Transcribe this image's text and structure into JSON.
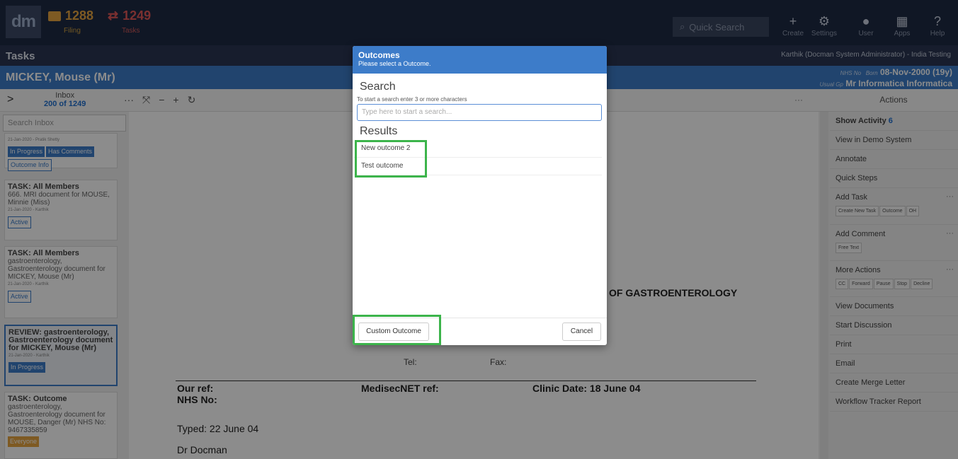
{
  "topbar": {
    "logo": "dm",
    "filing_count": "1288",
    "filing_label": "Filing",
    "tasks_count": "1249",
    "tasks_label": "Tasks",
    "quick_search_placeholder": "Quick Search",
    "nav": [
      {
        "label": "Create",
        "icon": "plus-icon"
      },
      {
        "label": "Settings",
        "icon": "gear-icon"
      },
      {
        "label": "User",
        "icon": "user-icon"
      },
      {
        "label": "Apps",
        "icon": "grid-icon"
      },
      {
        "label": "Help",
        "icon": "help-icon"
      }
    ]
  },
  "header": {
    "title": "Tasks",
    "user": "Karthik (Docman System Administrator) - India Testing"
  },
  "patient": {
    "name": "MICKEY, Mouse (Mr)",
    "nhs_label": "NHS No",
    "born_label": "Born",
    "born": "08-Nov-2000 (19y)",
    "gp_label": "Usual Gp",
    "gp": "Mr Informatica Informatica"
  },
  "inbox": {
    "label": "Inbox",
    "count": "200 of 1249",
    "search_placeholder": "Search Inbox",
    "cards": [
      {
        "type": "",
        "lines": "",
        "date": "21-Jan-2020 - Pratik Shetty",
        "tags": [
          "In Progress",
          "Has Comments",
          "Outcome Info"
        ]
      },
      {
        "type": "TASK: All Members",
        "lines": "666. MRI document for MOUSE, Minnie (Miss)",
        "date": "21-Jan-2020 - Karthik",
        "tags": [
          "Active"
        ]
      },
      {
        "type": "TASK: All Members",
        "lines": "gastroenterology, Gastroenterology document for MICKEY, Mouse (Mr)",
        "date": "21-Jan-2020 - Karthik",
        "tags": [
          "Active"
        ]
      },
      {
        "type": "REVIEW: gastroenterology, Gastroenterology document for MICKEY, Mouse (Mr)",
        "lines": "",
        "date": "21-Jan-2020 - Karthik",
        "tags": [
          "In Progress"
        ]
      },
      {
        "type": "TASK: Outcome",
        "lines": "gastroenterology, Gastroenterology document for MOUSE, Danger (Mr) NHS No: 9467335859",
        "date": "",
        "tags": [
          "Everyone"
        ]
      }
    ]
  },
  "document": {
    "heading": "OF GASTROENTEROLOGY",
    "tel": "Tel:",
    "fax": "Fax:",
    "our_ref": "Our ref:",
    "medisec_ref": "MedisecNET ref:",
    "clinic_date": "Clinic Date: 18 June 04",
    "nhs_no": "NHS No:",
    "typed": "Typed: 22 June 04",
    "doctor": "Dr Docman"
  },
  "actions": {
    "title": "Actions",
    "show_activity": "Show Activity",
    "activity_count": "6",
    "view_demo": "View in Demo System",
    "annotate": "Annotate",
    "quick_steps": "Quick Steps",
    "add_task": "Add Task",
    "add_task_buttons": [
      "Create New Task",
      "Outcome",
      "OH"
    ],
    "add_comment": "Add Comment",
    "free_text": "Free Text",
    "more_actions": "More Actions",
    "more_buttons": [
      "CC",
      "Forward",
      "Pause",
      "Stop",
      "Decline"
    ],
    "view_documents": "View Documents",
    "start_discussion": "Start Discussion",
    "print": "Print",
    "email": "Email",
    "merge_letter": "Create Merge Letter",
    "workflow": "Workflow Tracker Report"
  },
  "modal": {
    "title": "Outcomes",
    "subtitle": "Please select a Outcome.",
    "search_heading": "Search",
    "search_hint": "To start a search enter 3 or more characters",
    "search_placeholder": "Type here to start a search...",
    "results_heading": "Results",
    "results": [
      "New outcome 2",
      "Test outcome"
    ],
    "custom_button": "Custom Outcome",
    "cancel_button": "Cancel"
  },
  "colors": {
    "highlight": "#3cb44b",
    "brand_blue": "#3d7cc9",
    "topbar": "#1e2a44"
  }
}
